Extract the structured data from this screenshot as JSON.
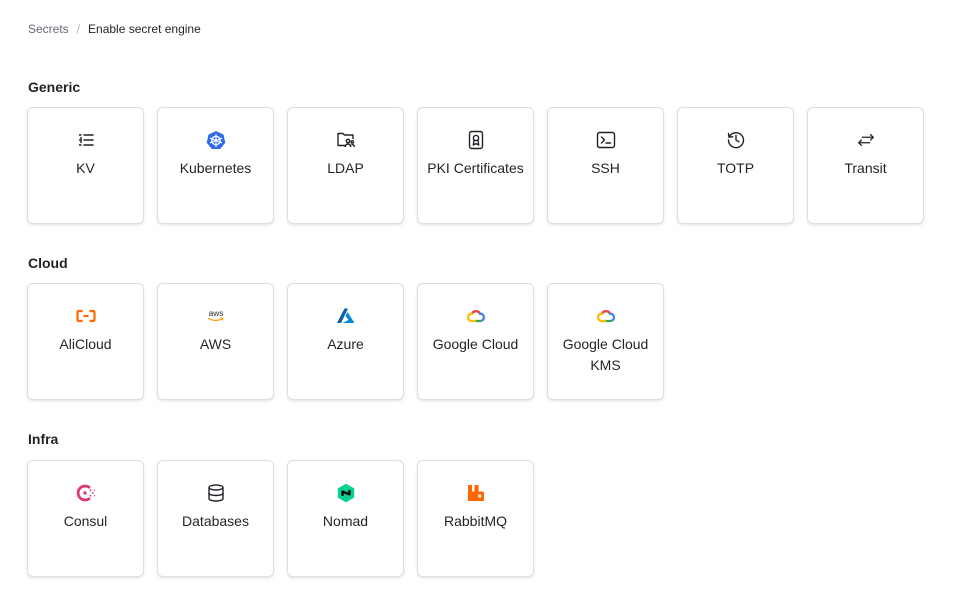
{
  "breadcrumb": {
    "parent": "Secrets",
    "separator": "/",
    "current": "Enable secret engine"
  },
  "sections": {
    "generic": {
      "title": "Generic",
      "items": [
        {
          "label": "KV",
          "icon": "list-icon"
        },
        {
          "label": "Kubernetes",
          "icon": "kubernetes-icon"
        },
        {
          "label": "LDAP",
          "icon": "folder-users-icon"
        },
        {
          "label": "PKI Certificates",
          "icon": "certificate-icon"
        },
        {
          "label": "SSH",
          "icon": "terminal-icon"
        },
        {
          "label": "TOTP",
          "icon": "history-icon"
        },
        {
          "label": "Transit",
          "icon": "arrows-left-right-icon"
        }
      ]
    },
    "cloud": {
      "title": "Cloud",
      "items": [
        {
          "label": "AliCloud",
          "icon": "alibaba-icon"
        },
        {
          "label": "AWS",
          "icon": "aws-icon"
        },
        {
          "label": "Azure",
          "icon": "azure-icon"
        },
        {
          "label": "Google Cloud",
          "icon": "google-cloud-icon"
        },
        {
          "label": "Google Cloud KMS",
          "icon": "google-cloud-icon"
        }
      ]
    },
    "infra": {
      "title": "Infra",
      "items": [
        {
          "label": "Consul",
          "icon": "consul-icon"
        },
        {
          "label": "Databases",
          "icon": "database-icon"
        },
        {
          "label": "Nomad",
          "icon": "nomad-icon"
        },
        {
          "label": "RabbitMQ",
          "icon": "rabbitmq-icon"
        }
      ]
    }
  },
  "colors": {
    "kubernetes": "#326ce5",
    "alibaba": "#ff6a00",
    "aws_smile": "#ff9900",
    "azure": "#0078d4",
    "consul": "#e03875",
    "nomad": "#06d092",
    "rabbitmq": "#ff6600"
  }
}
